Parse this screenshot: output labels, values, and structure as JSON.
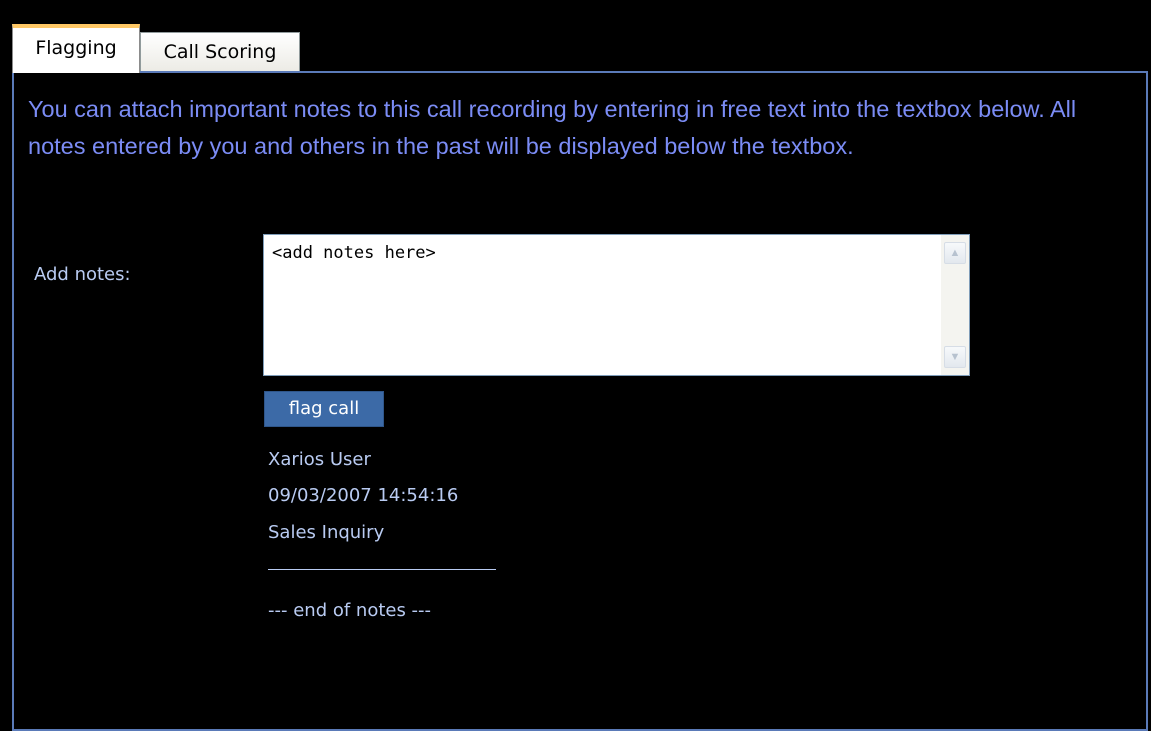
{
  "tabs": [
    {
      "label": "Flagging",
      "active": true
    },
    {
      "label": "Call Scoring",
      "active": false
    }
  ],
  "panel": {
    "intro_text": "You can attach important notes to this call recording by entering in free text into the textbox below. All notes entered by you and others in the past will be displayed below the textbox."
  },
  "notes_form": {
    "label": "Add notes:",
    "input_value": "<add notes here>",
    "submit_label": "flag call"
  },
  "notes": [
    {
      "author": "Xarios User",
      "timestamp": "09/03/2007 14:54:16",
      "text": "Sales Inquiry"
    }
  ],
  "end_marker": "--- end of notes ---",
  "colors": {
    "background": "#000000",
    "intro_text": "#7b8cf5",
    "label_text": "#b9cbf2",
    "button": "#3c6aa7",
    "panel_border": "#5a7ab8",
    "active_tab_accent": "#ffc865"
  },
  "icons": {
    "scroll_up": "chevron-up-icon",
    "scroll_down": "chevron-down-icon"
  }
}
